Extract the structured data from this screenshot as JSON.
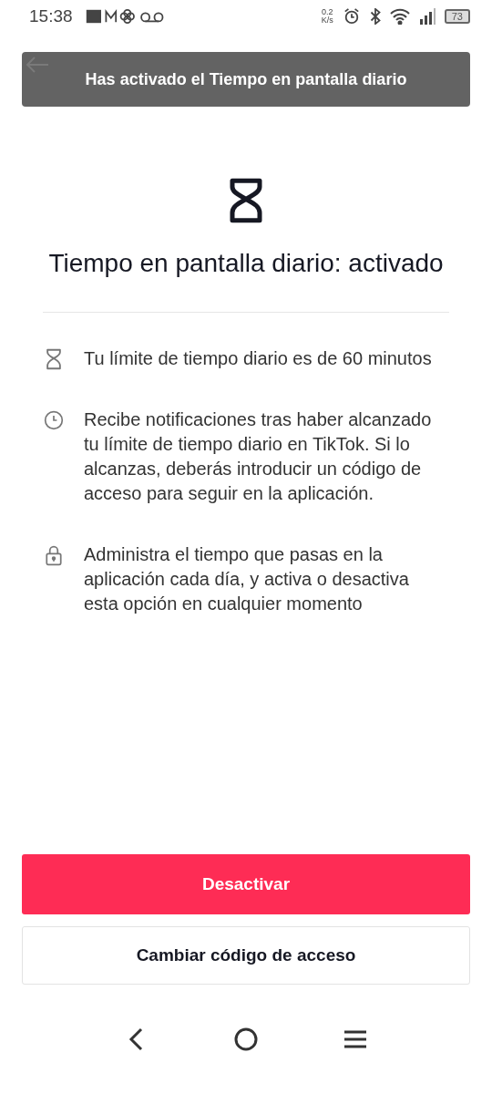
{
  "status_bar": {
    "time": "15:38",
    "net_speed": "0.2",
    "net_unit": "K/s",
    "battery": "73"
  },
  "toast": {
    "text": "Has activado el Tiempo en pantalla diario"
  },
  "title": "Tiempo en pantalla diario: activado",
  "items": [
    {
      "kind": "hourglass",
      "text": "Tu límite de tiempo diario es de 60 minutos"
    },
    {
      "kind": "clock",
      "text": "Recibe notificaciones tras haber alcanzado tu límite de tiempo diario en TikTok. Si lo alcanzas, deberás introducir un código de acceso para seguir en la aplicación."
    },
    {
      "kind": "lock",
      "text": "Administra el tiempo que pasas en la aplicación cada día, y activa o desactiva esta opción en cualquier momento"
    }
  ],
  "buttons": [
    {
      "kind": "primary",
      "label": "Desactivar"
    },
    {
      "kind": "secondary",
      "label": "Cambiar código de acceso"
    }
  ]
}
